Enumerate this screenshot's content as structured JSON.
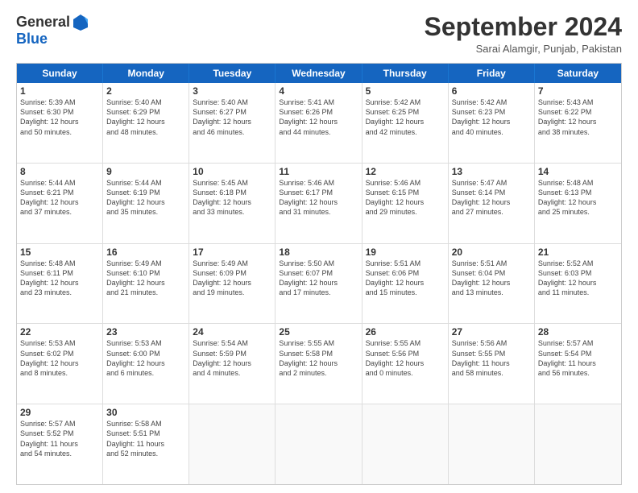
{
  "logo": {
    "general": "General",
    "blue": "Blue"
  },
  "title": "September 2024",
  "subtitle": "Sarai Alamgir, Punjab, Pakistan",
  "header_days": [
    "Sunday",
    "Monday",
    "Tuesday",
    "Wednesday",
    "Thursday",
    "Friday",
    "Saturday"
  ],
  "rows": [
    [
      {
        "day": "",
        "empty": true
      },
      {
        "day": "2",
        "line1": "Sunrise: 5:40 AM",
        "line2": "Sunset: 6:29 PM",
        "line3": "Daylight: 12 hours",
        "line4": "and 48 minutes."
      },
      {
        "day": "3",
        "line1": "Sunrise: 5:40 AM",
        "line2": "Sunset: 6:27 PM",
        "line3": "Daylight: 12 hours",
        "line4": "and 46 minutes."
      },
      {
        "day": "4",
        "line1": "Sunrise: 5:41 AM",
        "line2": "Sunset: 6:26 PM",
        "line3": "Daylight: 12 hours",
        "line4": "and 44 minutes."
      },
      {
        "day": "5",
        "line1": "Sunrise: 5:42 AM",
        "line2": "Sunset: 6:25 PM",
        "line3": "Daylight: 12 hours",
        "line4": "and 42 minutes."
      },
      {
        "day": "6",
        "line1": "Sunrise: 5:42 AM",
        "line2": "Sunset: 6:23 PM",
        "line3": "Daylight: 12 hours",
        "line4": "and 40 minutes."
      },
      {
        "day": "7",
        "line1": "Sunrise: 5:43 AM",
        "line2": "Sunset: 6:22 PM",
        "line3": "Daylight: 12 hours",
        "line4": "and 38 minutes."
      }
    ],
    [
      {
        "day": "1",
        "line1": "Sunrise: 5:39 AM",
        "line2": "Sunset: 6:30 PM",
        "line3": "Daylight: 12 hours",
        "line4": "and 50 minutes."
      },
      {
        "day": "9",
        "line1": "Sunrise: 5:44 AM",
        "line2": "Sunset: 6:19 PM",
        "line3": "Daylight: 12 hours",
        "line4": "and 35 minutes."
      },
      {
        "day": "10",
        "line1": "Sunrise: 5:45 AM",
        "line2": "Sunset: 6:18 PM",
        "line3": "Daylight: 12 hours",
        "line4": "and 33 minutes."
      },
      {
        "day": "11",
        "line1": "Sunrise: 5:46 AM",
        "line2": "Sunset: 6:17 PM",
        "line3": "Daylight: 12 hours",
        "line4": "and 31 minutes."
      },
      {
        "day": "12",
        "line1": "Sunrise: 5:46 AM",
        "line2": "Sunset: 6:15 PM",
        "line3": "Daylight: 12 hours",
        "line4": "and 29 minutes."
      },
      {
        "day": "13",
        "line1": "Sunrise: 5:47 AM",
        "line2": "Sunset: 6:14 PM",
        "line3": "Daylight: 12 hours",
        "line4": "and 27 minutes."
      },
      {
        "day": "14",
        "line1": "Sunrise: 5:48 AM",
        "line2": "Sunset: 6:13 PM",
        "line3": "Daylight: 12 hours",
        "line4": "and 25 minutes."
      }
    ],
    [
      {
        "day": "8",
        "line1": "Sunrise: 5:44 AM",
        "line2": "Sunset: 6:21 PM",
        "line3": "Daylight: 12 hours",
        "line4": "and 37 minutes."
      },
      {
        "day": "16",
        "line1": "Sunrise: 5:49 AM",
        "line2": "Sunset: 6:10 PM",
        "line3": "Daylight: 12 hours",
        "line4": "and 21 minutes."
      },
      {
        "day": "17",
        "line1": "Sunrise: 5:49 AM",
        "line2": "Sunset: 6:09 PM",
        "line3": "Daylight: 12 hours",
        "line4": "and 19 minutes."
      },
      {
        "day": "18",
        "line1": "Sunrise: 5:50 AM",
        "line2": "Sunset: 6:07 PM",
        "line3": "Daylight: 12 hours",
        "line4": "and 17 minutes."
      },
      {
        "day": "19",
        "line1": "Sunrise: 5:51 AM",
        "line2": "Sunset: 6:06 PM",
        "line3": "Daylight: 12 hours",
        "line4": "and 15 minutes."
      },
      {
        "day": "20",
        "line1": "Sunrise: 5:51 AM",
        "line2": "Sunset: 6:04 PM",
        "line3": "Daylight: 12 hours",
        "line4": "and 13 minutes."
      },
      {
        "day": "21",
        "line1": "Sunrise: 5:52 AM",
        "line2": "Sunset: 6:03 PM",
        "line3": "Daylight: 12 hours",
        "line4": "and 11 minutes."
      }
    ],
    [
      {
        "day": "15",
        "line1": "Sunrise: 5:48 AM",
        "line2": "Sunset: 6:11 PM",
        "line3": "Daylight: 12 hours",
        "line4": "and 23 minutes."
      },
      {
        "day": "23",
        "line1": "Sunrise: 5:53 AM",
        "line2": "Sunset: 6:00 PM",
        "line3": "Daylight: 12 hours",
        "line4": "and 6 minutes."
      },
      {
        "day": "24",
        "line1": "Sunrise: 5:54 AM",
        "line2": "Sunset: 5:59 PM",
        "line3": "Daylight: 12 hours",
        "line4": "and 4 minutes."
      },
      {
        "day": "25",
        "line1": "Sunrise: 5:55 AM",
        "line2": "Sunset: 5:58 PM",
        "line3": "Daylight: 12 hours",
        "line4": "and 2 minutes."
      },
      {
        "day": "26",
        "line1": "Sunrise: 5:55 AM",
        "line2": "Sunset: 5:56 PM",
        "line3": "Daylight: 12 hours",
        "line4": "and 0 minutes."
      },
      {
        "day": "27",
        "line1": "Sunrise: 5:56 AM",
        "line2": "Sunset: 5:55 PM",
        "line3": "Daylight: 11 hours",
        "line4": "and 58 minutes."
      },
      {
        "day": "28",
        "line1": "Sunrise: 5:57 AM",
        "line2": "Sunset: 5:54 PM",
        "line3": "Daylight: 11 hours",
        "line4": "and 56 minutes."
      }
    ],
    [
      {
        "day": "22",
        "line1": "Sunrise: 5:53 AM",
        "line2": "Sunset: 6:02 PM",
        "line3": "Daylight: 12 hours",
        "line4": "and 8 minutes."
      },
      {
        "day": "30",
        "line1": "Sunrise: 5:58 AM",
        "line2": "Sunset: 5:51 PM",
        "line3": "Daylight: 11 hours",
        "line4": "and 52 minutes."
      },
      {
        "day": "",
        "empty": true
      },
      {
        "day": "",
        "empty": true
      },
      {
        "day": "",
        "empty": true
      },
      {
        "day": "",
        "empty": true
      },
      {
        "day": "",
        "empty": true
      }
    ],
    [
      {
        "day": "29",
        "line1": "Sunrise: 5:57 AM",
        "line2": "Sunset: 5:52 PM",
        "line3": "Daylight: 11 hours",
        "line4": "and 54 minutes."
      },
      {
        "day": "",
        "empty": true
      },
      {
        "day": "",
        "empty": true
      },
      {
        "day": "",
        "empty": true
      },
      {
        "day": "",
        "empty": true
      },
      {
        "day": "",
        "empty": true
      },
      {
        "day": "",
        "empty": true
      }
    ]
  ]
}
